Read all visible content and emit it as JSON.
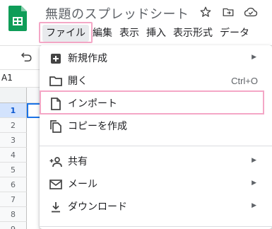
{
  "document": {
    "title": "無題のスプレッドシート"
  },
  "menubar": {
    "items": [
      {
        "label": "ファイル",
        "active": true
      },
      {
        "label": "編集"
      },
      {
        "label": "表示"
      },
      {
        "label": "挿入"
      },
      {
        "label": "表示形式"
      },
      {
        "label": "データ"
      }
    ]
  },
  "namebox": {
    "value": "A1"
  },
  "rows": [
    "1",
    "2",
    "3",
    "4",
    "5",
    "6",
    "7",
    "8",
    "9"
  ],
  "file_menu": {
    "items": [
      {
        "label": "新規作成",
        "icon": "add-box-icon",
        "submenu": true
      },
      {
        "label": "開く",
        "icon": "folder-icon",
        "shortcut": "Ctrl+O"
      },
      {
        "label": "インポート",
        "icon": "file-icon",
        "highlighted": true
      },
      {
        "label": "コピーを作成",
        "icon": "copy-icon"
      },
      {
        "label": "共有",
        "icon": "person-add-icon",
        "submenu": true
      },
      {
        "label": "メール",
        "icon": "mail-icon",
        "submenu": true
      },
      {
        "label": "ダウンロード",
        "icon": "download-icon",
        "submenu": true
      }
    ]
  },
  "colors": {
    "highlight": "#f4a7c6",
    "sheets_green": "#0f9d58",
    "selection": "#1a73e8"
  }
}
